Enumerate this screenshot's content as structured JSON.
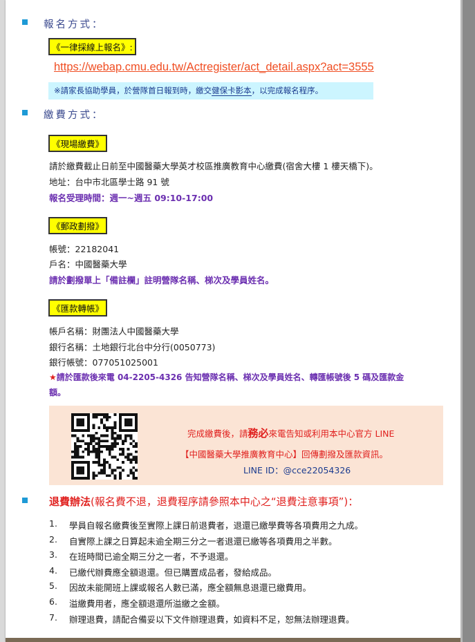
{
  "registration": {
    "title": "報名方式：",
    "label": "《一律採線上報名》:",
    "url": "https://webap.cmu.edu.tw/Actregister/act_detail.aspx?act=3555",
    "note_prefix": "※請家長協助學員，於營隊首日報到時，繳交",
    "note_underline": "健保卡影本",
    "note_suffix": "，以完成報名程序。"
  },
  "payment": {
    "title": "繳費方式：",
    "onsite": {
      "label": "《現場繳費》",
      "line1": "請於繳費截止日前至中國醫藥大學英才校區推廣教育中心繳費(宿舍大樓 1 樓天橋下)。",
      "line2": "地址：台中市北區學士路 91 號",
      "line3": "報名受理時間：週一~週五 09:10-17:00"
    },
    "postal": {
      "label": "《郵政劃撥》",
      "line1": "帳號：22182041",
      "line2": "戶名：中國醫藥大學",
      "line3": "請於劃撥單上「備註欄」註明營隊名稱、梯次及學員姓名。"
    },
    "transfer": {
      "label": "《匯款轉帳》",
      "line1": "帳戶名稱：財團法人中國醫藥大學",
      "line2": "銀行名稱：土地銀行北台中分行(0050773)",
      "line3": "銀行帳號：077051025001",
      "star": "★",
      "line4a": "請於匯款後來電 04-2205-4326 告知營隊名稱、梯次及學員姓名、轉匯帳號後 5 碼及匯款金",
      "line4b": "額。"
    },
    "notice": {
      "line1_pre": "完成繳費後，請",
      "line1_em": "務必",
      "line1_post": "來電告知或利用本中心官方 LINE",
      "line2": "【中國醫藥大學推廣教育中心】回傳劃撥及匯款資訊。",
      "line3": "LINE ID：@cce22054326"
    }
  },
  "refund": {
    "title_bold": "退費辦法",
    "title_rest": "(報名費不退，退費程序請參照本中心之“退費注意事項”)：",
    "items": [
      {
        "num": "1.",
        "text": "學員自報名繳費後至實際上課日前退費者，退還已繳學費等各項費用之九成。"
      },
      {
        "num": "2.",
        "text": "自實際上課之日算起未逾全期三分之一者退還已繳等各項費用之半數。"
      },
      {
        "num": "3.",
        "text": "在班時間已逾全期三分之一者，不予退還。"
      },
      {
        "num": "4.",
        "text": "已繳代辦費應全額退還。但已購置成品者，發給成品。"
      },
      {
        "num": "5.",
        "text": "因故未能開班上課或報名人數已滿，應全額無息退還已繳費用。"
      },
      {
        "num": "6.",
        "text": "溢繳費用者，應全額退還所溢繳之金額。"
      },
      {
        "num": "7.",
        "text": "辦理退費，請配合備妥以下文件辦理退費，如資料不足，恕無法辦理退費。"
      }
    ]
  },
  "colors": {
    "accent_blue": "#1e9ad6",
    "link_orange": "#f04e23",
    "purple": "#6b2fb0",
    "red": "#e0201e",
    "peach": "#fbe4d5",
    "highlight": "#ffff00"
  }
}
